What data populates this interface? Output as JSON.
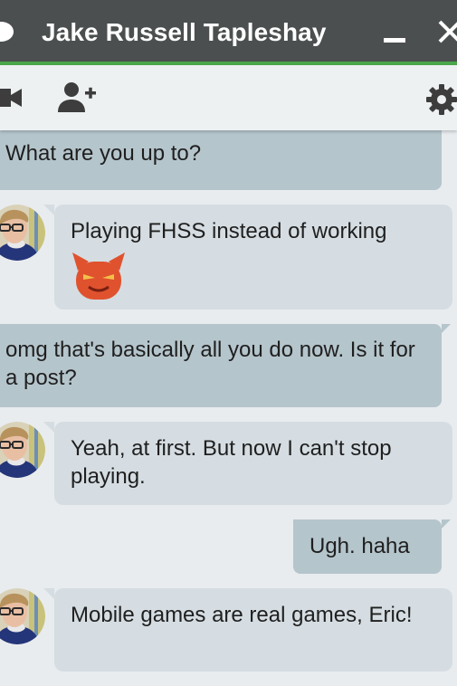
{
  "window": {
    "title": "Jake Russell Tapleshay"
  },
  "toolbar": {
    "video_icon": "video-camera-icon",
    "add_icon": "add-person-icon",
    "settings_icon": "gear-icon"
  },
  "colors": {
    "titlebar": "#4b4f4f",
    "accent": "#4aa74a",
    "outgoing_bubble": "#b5c5cc",
    "incoming_bubble": "#d5dde2",
    "background": "#e8ecef"
  },
  "messages": [
    {
      "direction": "outgoing",
      "text": "What are you up to?"
    },
    {
      "direction": "incoming",
      "text": "Playing FHSS instead of working",
      "emoji": "smiling-devil-emoji"
    },
    {
      "direction": "outgoing",
      "text": "omg that's basically all you do now. Is it for a post?"
    },
    {
      "direction": "incoming",
      "text": "Yeah, at first. But now I can't stop playing."
    },
    {
      "direction": "outgoing",
      "text": "Ugh. haha"
    },
    {
      "direction": "incoming",
      "text": "Mobile games are real games, Eric!"
    }
  ]
}
